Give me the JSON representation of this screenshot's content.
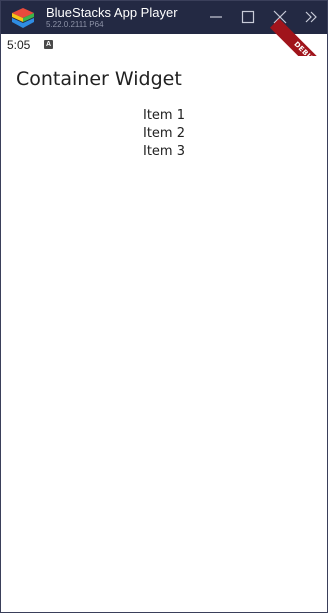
{
  "window": {
    "title": "BlueStacks App Player",
    "version": "5.22.0.2111 P64",
    "colors": {
      "titlebar_bg": "#232943",
      "version_text": "#8e93a8",
      "logo_colors": [
        "#e84b3c",
        "#f5c518",
        "#3bb54a",
        "#2f8de4"
      ]
    },
    "controls": {
      "minimize_icon": "minimize-icon",
      "maximize_icon": "maximize-icon",
      "close_icon": "close-icon",
      "more_icon": "double-chevron-right-icon"
    }
  },
  "status_bar": {
    "time": "5:05",
    "indicator_letter": "A"
  },
  "debug_banner": {
    "label": "DEBUG",
    "color": "#a0141b"
  },
  "app": {
    "title": "Container Widget",
    "items": [
      "Item 1",
      "Item 2",
      "Item 3"
    ]
  }
}
